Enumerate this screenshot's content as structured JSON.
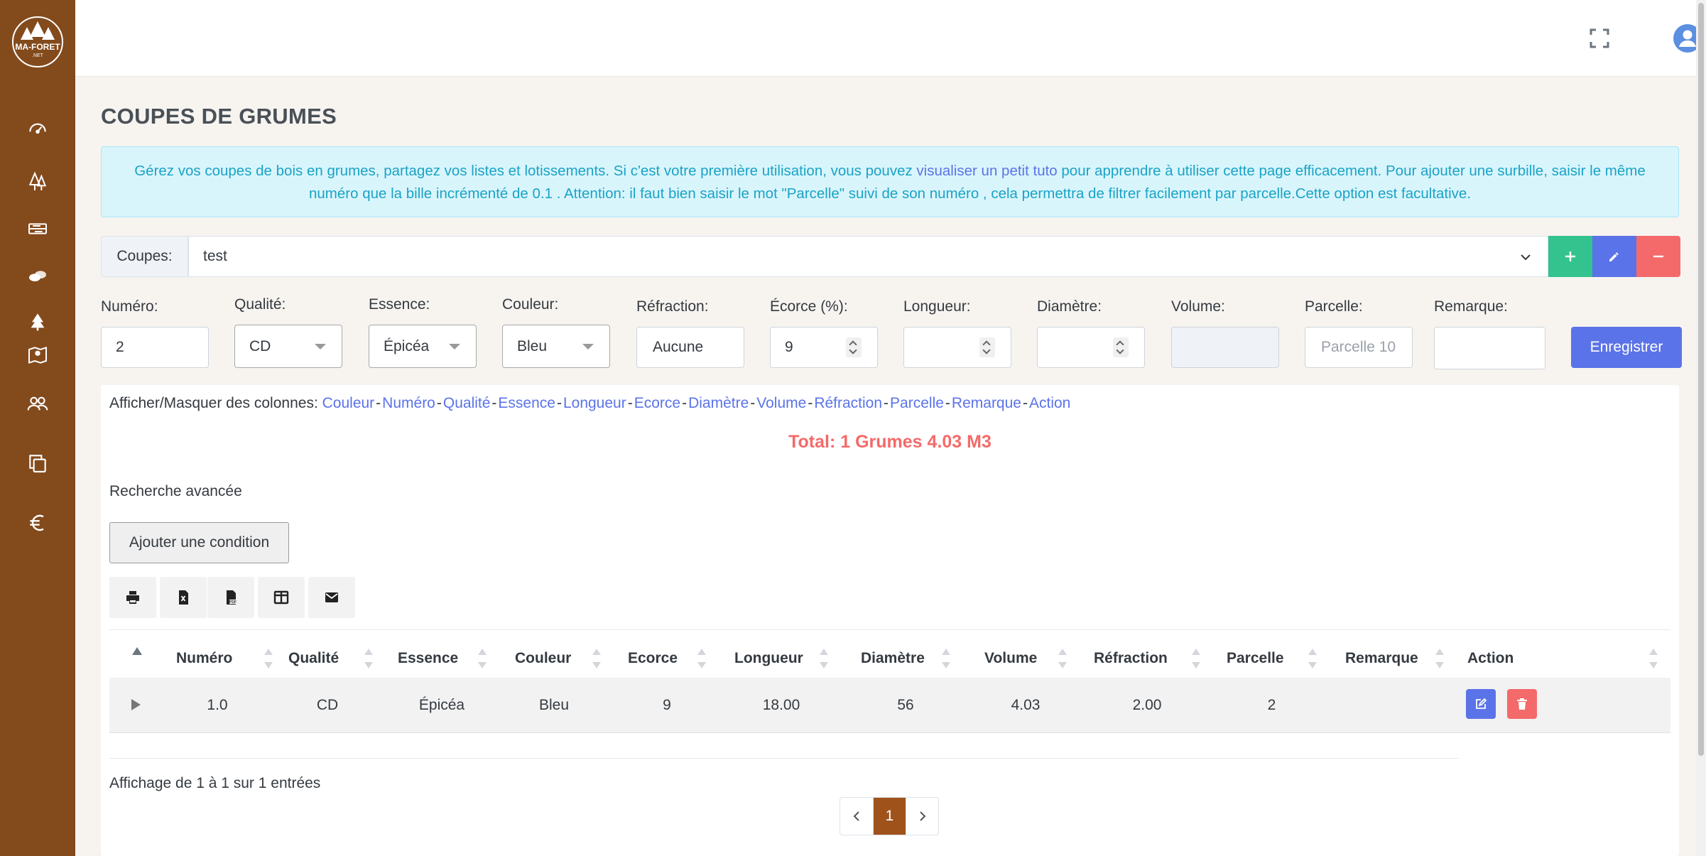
{
  "brand": {
    "logo_text": "MA-FORET.NET",
    "sidebar_color": "#834a1c"
  },
  "sidebar": {
    "items": [
      {
        "icon": "dashboard-icon"
      },
      {
        "icon": "trees-icon"
      },
      {
        "icon": "wood-planks-icon"
      },
      {
        "icon": "logs-icon"
      },
      {
        "icon": "fir-tree-icon"
      },
      {
        "icon": "map-icon"
      },
      {
        "icon": "users-icon"
      },
      {
        "icon": "copy-icon"
      },
      {
        "icon": "euro-icon"
      }
    ]
  },
  "header": {
    "fullscreen_icon": "fullscreen-icon",
    "user_icon": "user-avatar-icon"
  },
  "page": {
    "title": "COUPES DE GRUMES"
  },
  "alert": {
    "text_before": "Gérez vos coupes de bois en grumes, partagez vos listes et lotissements. Si c'est votre première utilisation, vous pouvez ",
    "link": "visualiser un petit tuto",
    "text_after": " pour apprendre à utiliser cette page efficacement. Pour ajouter une surbille, saisir le même numéro que la bille incrémenté de 0.1 . Attention: il faut bien saisir le mot \"Parcelle\" suivi de son numéro , cela permettra de filtrer facilement par parcelle.Cette option est facultative."
  },
  "coupes": {
    "label": "Coupes:",
    "selected": "test"
  },
  "form": {
    "numero": {
      "label": "Numéro:",
      "value": "2"
    },
    "qualite": {
      "label": "Qualité:",
      "value": "CD"
    },
    "essence": {
      "label": "Essence:",
      "value": "Épicéa"
    },
    "couleur": {
      "label": "Couleur:",
      "value": "Bleu"
    },
    "refraction": {
      "label": "Réfraction:",
      "value": "Aucune"
    },
    "ecorce": {
      "label": "Écorce (%):",
      "value": "9"
    },
    "longueur": {
      "label": "Longueur:",
      "value": ""
    },
    "diametre": {
      "label": "Diamètre:",
      "value": ""
    },
    "volume": {
      "label": "Volume:",
      "value": ""
    },
    "parcelle": {
      "label": "Parcelle:",
      "placeholder": "Parcelle 10"
    },
    "remarque": {
      "label": "Remarque:",
      "value": ""
    },
    "save_label": "Enregistrer"
  },
  "columns_toggle": {
    "label": "Afficher/Masquer des colonnes:",
    "links": [
      "Couleur",
      "Numéro",
      "Qualité",
      "Essence",
      "Longueur",
      "Ecorce",
      "Diamètre",
      "Volume",
      "Réfraction",
      "Parcelle",
      "Remarque",
      "Action"
    ]
  },
  "total": "Total: 1 Grumes 4.03 M3",
  "advanced": {
    "label": "Recherche avancée",
    "add_condition": "Ajouter une condition"
  },
  "export_buttons": [
    "print-icon",
    "excel-icon",
    "pdf-icon",
    "columns-icon",
    "email-icon"
  ],
  "table": {
    "headers": [
      "Numéro",
      "Qualité",
      "Essence",
      "Couleur",
      "Ecorce",
      "Longueur",
      "Diamètre",
      "Volume",
      "Réfraction",
      "Parcelle",
      "Remarque",
      "Action"
    ],
    "rows": [
      {
        "numero": "1.0",
        "qualite": "CD",
        "essence": "Épicéa",
        "couleur": "Bleu",
        "ecorce": "9",
        "longueur": "18.00",
        "diametre": "56",
        "volume": "4.03",
        "refraction": "2.00",
        "parcelle": "2",
        "remarque": ""
      }
    ]
  },
  "footer": {
    "info": "Affichage de 1 à 1 sur 1 entrées",
    "current_page": "1"
  },
  "colors": {
    "primary": "#5b73e8",
    "success": "#34c38f",
    "danger": "#f46a6a",
    "info": "#1aa3c6",
    "brand": "#a0521b"
  }
}
